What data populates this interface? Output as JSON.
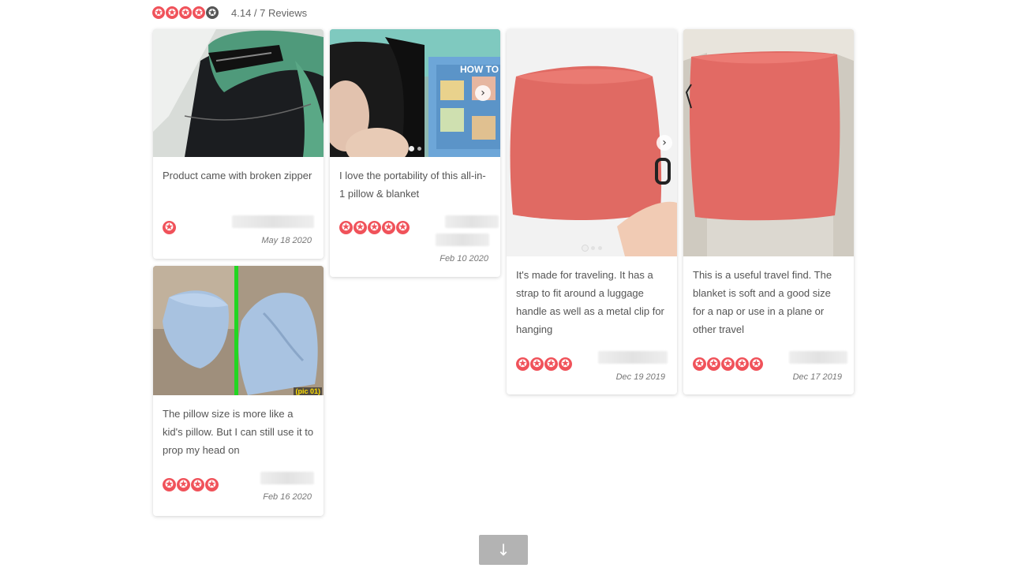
{
  "summary": {
    "rating_value": 4.14,
    "stars": [
      true,
      true,
      true,
      true,
      false
    ],
    "text": "4.14 / 7 Reviews"
  },
  "reviews": [
    {
      "text": "Product came with broken zipper",
      "rating": 1,
      "date": "May 18 2020",
      "photo_count": 1
    },
    {
      "text": "I love the portability of this all-in-1 pillow & blanket",
      "rating": 5,
      "date": "Feb 10 2020",
      "photo_count": 2,
      "photo_caption": "HOW TO"
    },
    {
      "text": "It's made for traveling. It has a strap to fit around a luggage handle as well as a metal clip for hanging",
      "rating": 4,
      "date": "Dec 19 2019",
      "photo_count": 3
    },
    {
      "text": "This is a useful travel find. The blanket is soft and a good size for a nap or use in a plane or other travel",
      "rating": 5,
      "date": "Dec 17 2019",
      "photo_count": 1
    },
    {
      "text": "The pillow size is more like a kid's pillow. But I can still use it to prop my head on",
      "rating": 4,
      "date": "Feb 16 2020",
      "photo_count": 1,
      "photo_caption": "(pic 01)"
    }
  ],
  "icons": {
    "star": "star-icon",
    "next": "chevron-right-icon",
    "load_more": "arrow-down-icon"
  },
  "glyphs": {
    "star": "✪",
    "next": "›",
    "load_more": "↓"
  },
  "colors": {
    "star": "#f0525a",
    "star_empty": "#555555",
    "button": "#b3b3b3"
  }
}
